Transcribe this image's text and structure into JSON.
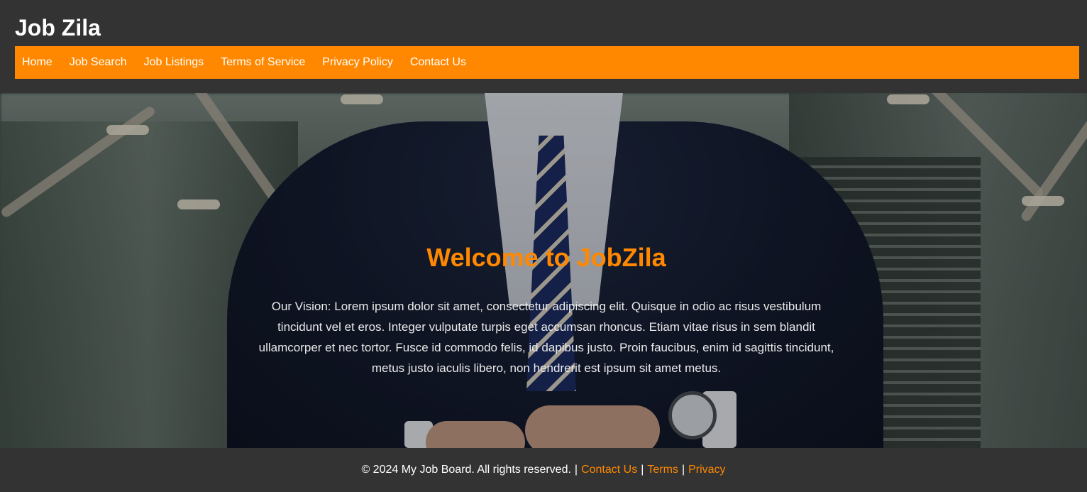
{
  "header": {
    "brand": "Job Zila",
    "nav": [
      {
        "label": "Home"
      },
      {
        "label": "Job Search"
      },
      {
        "label": "Job Listings"
      },
      {
        "label": "Terms of Service"
      },
      {
        "label": "Privacy Policy"
      },
      {
        "label": "Contact Us"
      }
    ]
  },
  "hero": {
    "title": "Welcome to JobZila",
    "text": "Our Vision: Lorem ipsum dolor sit amet, consectetur adipiscing elit. Quisque in odio ac risus vestibulum tincidunt vel et eros. Integer vulputate turpis eget accumsan rhoncus. Etiam vitae risus in sem blandit ullamcorper et nec tortor. Fusce id commodo felis, id dapibus justo. Proin faucibus, enim id sagittis tincidunt, metus justo iaculis libero, non hendrerit est ipsum sit amet metus."
  },
  "footer": {
    "copyright": "© 2024 My Job Board. All rights reserved.",
    "separator": "|",
    "links": [
      {
        "label": "Contact Us"
      },
      {
        "label": "Terms"
      },
      {
        "label": "Privacy"
      }
    ]
  },
  "colors": {
    "background": "#333333",
    "accent": "#ff8800",
    "text": "#ffffff"
  }
}
